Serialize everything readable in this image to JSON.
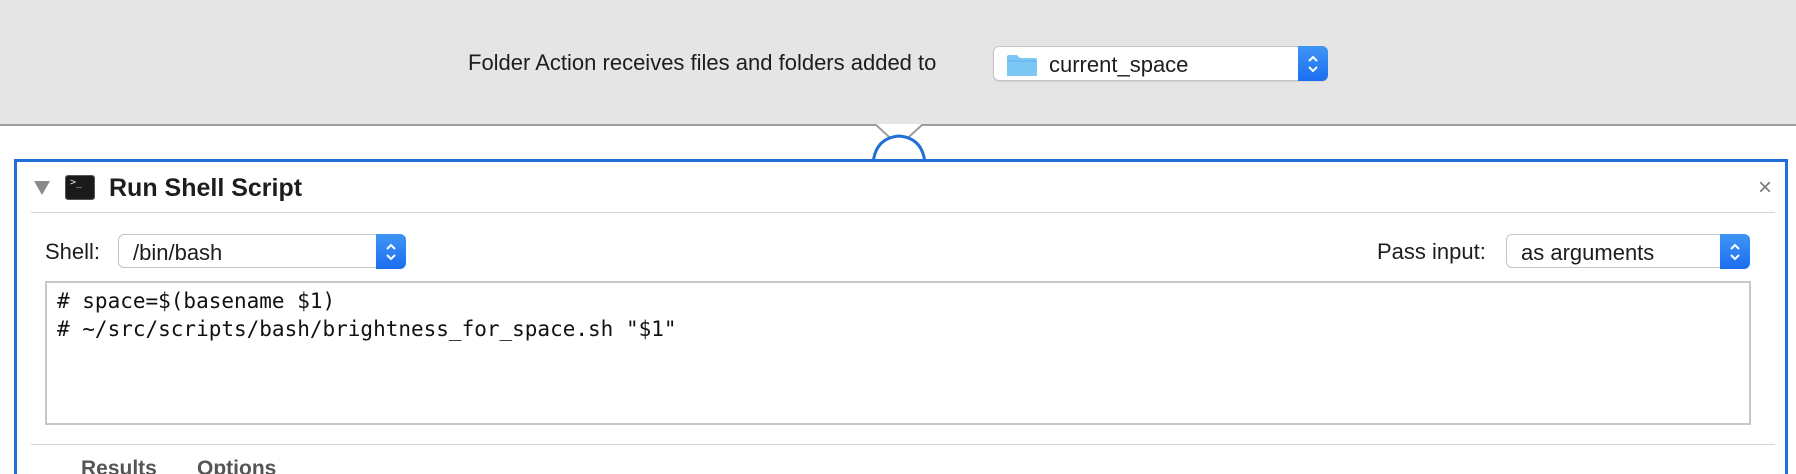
{
  "workflow_header": {
    "receives_label": "Folder Action receives files and folders added to",
    "folder_selected": "current_space",
    "folder_icon": "folder-icon"
  },
  "action": {
    "title": "Run Shell Script",
    "icon": "terminal-icon",
    "terminal_prompt": ">_",
    "close_symbol": "×",
    "shell_label": "Shell:",
    "shell_value": "/bin/bash",
    "pass_input_label": "Pass input:",
    "pass_input_value": "as arguments",
    "script_lines": [
      "# space=$(basename $1)",
      "# ~/src/scripts/bash/brightness_for_space.sh \"$1\""
    ],
    "tabs": [
      {
        "label": "Results"
      },
      {
        "label": "Options"
      }
    ]
  },
  "colors": {
    "header_bg": "#e5e5e5",
    "accent_blue": "#1f6fd6",
    "stepper_blue": "#2a7ff2",
    "folder_blue": "#7cc6f3"
  }
}
